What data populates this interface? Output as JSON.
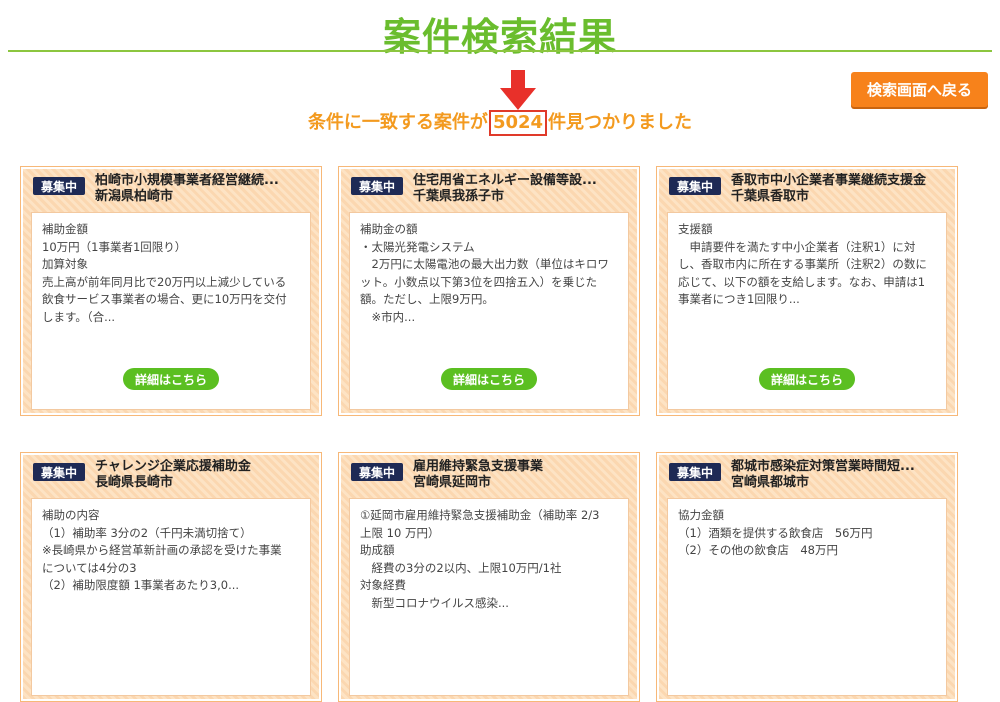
{
  "page": {
    "title": "案件検索結果",
    "back_button_label": "検索画面へ戻る",
    "result_prefix": "条件に一致する案件が",
    "result_count": "5024",
    "result_suffix": "件見つかりました"
  },
  "colors": {
    "title_green": "#6abd2e",
    "accent_orange": "#f7821b",
    "result_orange": "#f39a1f",
    "highlight_red": "#e03a2a",
    "badge_navy": "#1e2a55",
    "detail_green": "#5bbf21"
  },
  "icons": {
    "arrow": "arrow-down-icon"
  },
  "cards": [
    {
      "badge": "募集中",
      "title_line1": "柏崎市小規模事業者経営継続...",
      "title_line2": "新潟県柏崎市",
      "lines": [
        "補助金額",
        "10万円（1事業者1回限り）",
        "",
        "加算対象",
        "売上高が前年同月比で20万円以上減少している",
        "飲食サービス事業者の場合、更に10万円を交付",
        "します。（合..."
      ],
      "detail_label": "詳細はこちら"
    },
    {
      "badge": "募集中",
      "title_line1": "住宅用省エネルギー設備等設...",
      "title_line2": "千葉県我孫子市",
      "lines": [
        "補助金の額",
        "・太陽光発電システム",
        "　2万円に太陽電池の最大出力数（単位はキロワ",
        "ット。小数点以下第3位を四捨五入）を乗じた",
        "額。ただし、上限9万円。",
        "　※市内..."
      ],
      "detail_label": "詳細はこちら"
    },
    {
      "badge": "募集中",
      "title_line1": "香取市中小企業者事業継続支援金",
      "title_line2": "千葉県香取市",
      "lines": [
        "支援額",
        "　申請要件を満たす中小企業者（注釈1）に対",
        "し、香取市内に所在する事業所（注釈2）の数に",
        "応じて、以下の額を支給します。なお、申請は1",
        "事業者につき1回限り..."
      ],
      "detail_label": "詳細はこちら"
    },
    {
      "badge": "募集中",
      "title_line1": "チャレンジ企業応援補助金",
      "title_line2": "長崎県長崎市",
      "lines": [
        "補助の内容",
        "（1）補助率 3分の2（千円未満切捨て）",
        "※長崎県から経営革新計画の承認を受けた事業",
        "については4分の3",
        "（2）補助限度額 1事業者あたり3,0..."
      ],
      "detail_label": ""
    },
    {
      "badge": "募集中",
      "title_line1": "雇用維持緊急支援事業",
      "title_line2": "宮崎県延岡市",
      "lines": [
        "①延岡市雇用維持緊急支援補助金（補助率 2/3",
        "上限 10 万円）",
        "助成額",
        "　経費の3分の2以内、上限10万円/1社",
        "対象経費",
        "　新型コロナウイルス感染..."
      ],
      "detail_label": ""
    },
    {
      "badge": "募集中",
      "title_line1": "都城市感染症対策営業時間短...",
      "title_line2": "宮崎県都城市",
      "lines": [
        "協力金額",
        "（1）酒類を提供する飲食店　56万円",
        "（2）その他の飲食店　48万円"
      ],
      "detail_label": ""
    }
  ]
}
